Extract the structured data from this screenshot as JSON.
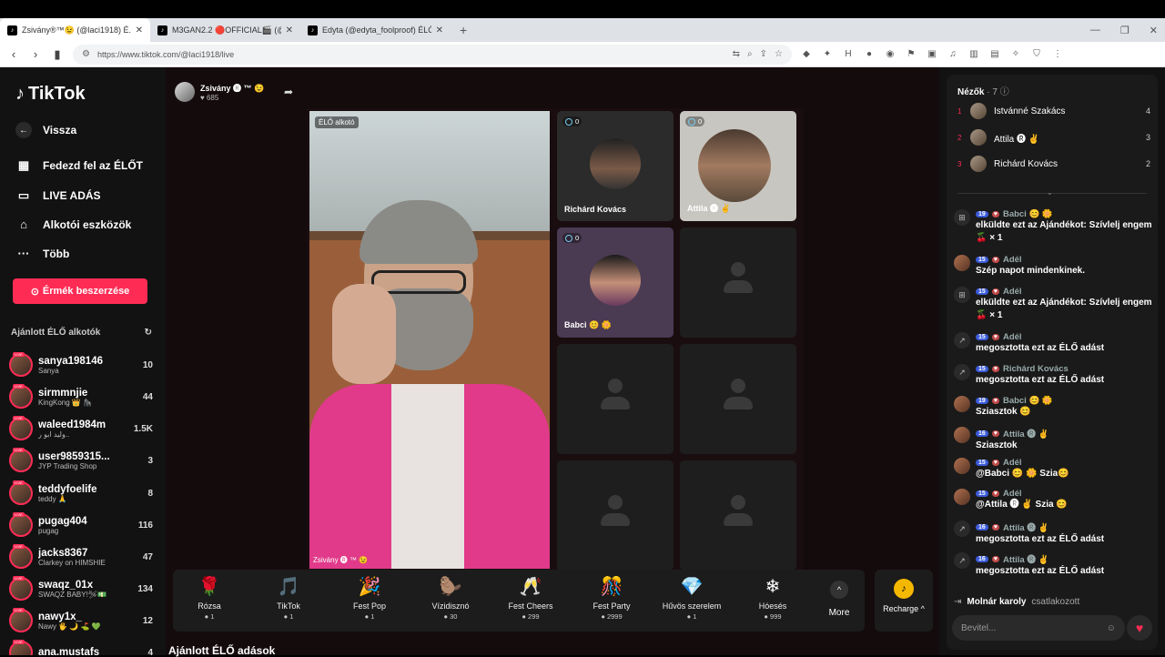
{
  "browser": {
    "tabs": [
      {
        "title": "Zsivány®™😉 (@laci1918) É..."
      },
      {
        "title": "M3GAN2.2 🔴OFFICIAL🎬 (@m3g..."
      },
      {
        "title": "Edyta (@edyta_foolproof) ÉLŐ ad..."
      }
    ],
    "url": "https://www.tiktok.com/@laci1918/live"
  },
  "sidebar": {
    "logo": "TikTok",
    "back": "Vissza",
    "explore": "Fedezd fel az ÉLŐT",
    "live": "LIVE ADÁS",
    "creator_tools": "Alkotói eszközök",
    "more": "Több",
    "coins_button": "Érmék beszerzése",
    "recommended_header": "Ajánlott ÉLŐ alkotók",
    "creators": [
      {
        "user": "sanya198146",
        "sub": "Sanya",
        "count": "10"
      },
      {
        "user": "sirmmnjie",
        "sub": "KingKong 👑 🦍",
        "count": "44"
      },
      {
        "user": "waleed1984m",
        "sub": "وليد ابو ر..",
        "count": "1.5K"
      },
      {
        "user": "user9859315...",
        "sub": "JYP Trading Shop",
        "count": "3"
      },
      {
        "user": "teddyfoelife",
        "sub": "teddy 🙏",
        "count": "8"
      },
      {
        "user": "pugag404",
        "sub": "pugag",
        "count": "116"
      },
      {
        "user": "jacks8367",
        "sub": "Clarkey on HIMSHIE",
        "count": "47"
      },
      {
        "user": "swaqz_01x",
        "sub": "SWAQZ BABY!🛩💵",
        "count": "134"
      },
      {
        "user": "nawy1x_",
        "sub": "Nawy 🖐 🌙 ⛳ 💚",
        "count": "12"
      },
      {
        "user": "ana.mustafs",
        "sub": "",
        "count": "4"
      }
    ]
  },
  "stage": {
    "host_name": "Zsivány 🅡 ™ 😉",
    "host_views": "♥ 685",
    "main_tag": "ÉLŐ alkotó",
    "main_name": "Zsivány 🅡 ™ 😉",
    "guests": [
      {
        "name": "Richárd Kovács",
        "badge": "0"
      },
      {
        "name": "Attila 🅡 ✌",
        "badge": "0"
      },
      {
        "name": "Babci 😊 🌼",
        "badge": "0"
      }
    ],
    "gifts": [
      {
        "name": "Rózsa",
        "price": "1",
        "icon": "🌹"
      },
      {
        "name": "TikTok",
        "price": "1",
        "icon": "🎵"
      },
      {
        "name": "Fest Pop",
        "price": "1",
        "icon": "🎉"
      },
      {
        "name": "Vízidisznó",
        "price": "30",
        "icon": "🦫"
      },
      {
        "name": "Fest Cheers",
        "price": "299",
        "icon": "🥂"
      },
      {
        "name": "Fest Party",
        "price": "2999",
        "icon": "🎊"
      },
      {
        "name": "Hűvös szerelem",
        "price": "1",
        "icon": "💎"
      },
      {
        "name": "Hóesés",
        "price": "999",
        "icon": "❄"
      }
    ],
    "more_label": "More",
    "recharge_label": "Recharge ^",
    "recommended_lives": "Ajánlott ÉLŐ adások"
  },
  "chat": {
    "viewers_title": "Nézők",
    "viewers_count": "· 7",
    "viewers": [
      {
        "rank": "1",
        "name": "Istvánné Szakács",
        "count": "4"
      },
      {
        "rank": "2",
        "name": "Attila 🅡 ✌",
        "count": "3"
      },
      {
        "rank": "3",
        "name": "Richárd Kovács",
        "count": "2"
      }
    ],
    "messages": [
      {
        "level": "19",
        "name": "Babci 😊 🌼",
        "text": "elküldte ezt az Ajándékot: Szívlelj engem 🍒 × 1",
        "avatar": "gift"
      },
      {
        "level": "15",
        "name": "Adél",
        "text": "Szép napot mindenkinek.",
        "avatar": "photo"
      },
      {
        "level": "15",
        "name": "Adél",
        "text": "elküldte ezt az Ajándékot: Szívlelj engem 🍒 × 1",
        "avatar": "gift"
      },
      {
        "level": "15",
        "name": "Adél",
        "text": "megosztotta ezt az ÉLŐ adást",
        "avatar": "share"
      },
      {
        "level": "15",
        "name": "Richárd Kovács",
        "text": "megosztotta ezt az ÉLŐ adást",
        "avatar": "share"
      },
      {
        "level": "19",
        "name": "Babci 😊 🌼",
        "text": "Sziasztok 😊",
        "avatar": "photo"
      },
      {
        "level": "16",
        "name": "Attila 🅡 ✌",
        "text": "Sziasztok",
        "avatar": "photo"
      },
      {
        "level": "15",
        "name": "Adél",
        "text": "@Babci 😊 🌼 Szia😊",
        "avatar": "photo"
      },
      {
        "level": "15",
        "name": "Adél",
        "text": "@Attila 🅡 ✌ Szia 😊",
        "avatar": "photo"
      },
      {
        "level": "16",
        "name": "Attila 🅡 ✌",
        "text": "megosztotta ezt az ÉLŐ adást",
        "avatar": "share"
      },
      {
        "level": "16",
        "name": "Attila 🅡 ✌",
        "text": "megosztotta ezt az ÉLŐ adást",
        "avatar": "share"
      }
    ],
    "join_user": "Molnár karoly",
    "join_text": "csatlakozott",
    "input_placeholder": "Bevitel..."
  }
}
